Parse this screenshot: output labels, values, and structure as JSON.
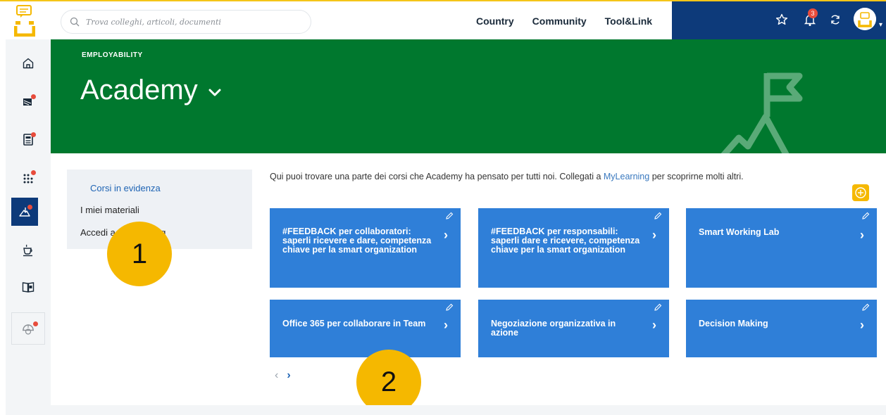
{
  "search": {
    "placeholder": "Trova colleghi, articoli, documenti"
  },
  "topnav": [
    "Country",
    "Community",
    "Tool&Link"
  ],
  "notifications": {
    "count": "3"
  },
  "hero": {
    "eyebrow": "EMPLOYABILITY",
    "title": "Academy"
  },
  "sidemenu": {
    "items": [
      {
        "label": "Corsi in evidenza"
      },
      {
        "label": "I miei materiali"
      },
      {
        "label": "Accedi a MyLearning"
      }
    ]
  },
  "intro": {
    "prefix": "Qui puoi trovare una parte dei corsi che Academy ha pensato per tutti noi. Collegati a ",
    "link": "MyLearning",
    "suffix": " per scoprirne molti altri."
  },
  "cards": [
    {
      "title": "#FEEDBACK per collaboratori: saperli ricevere e dare, competenza chiave per la smart organization"
    },
    {
      "title": "#FEEDBACK per responsabili: saperli dare e ricevere, competenza chiave per la smart organization"
    },
    {
      "title": "Smart Working Lab"
    },
    {
      "title": "Office 365 per collaborare in Team"
    },
    {
      "title": "Negoziazione organizzativa in azione"
    },
    {
      "title": "Decision Making"
    }
  ],
  "markers": [
    "1",
    "2"
  ],
  "colors": {
    "hero": "#00782e",
    "card": "#2f7fd8",
    "navy": "#0d3a7a",
    "accent": "#f5b800"
  }
}
